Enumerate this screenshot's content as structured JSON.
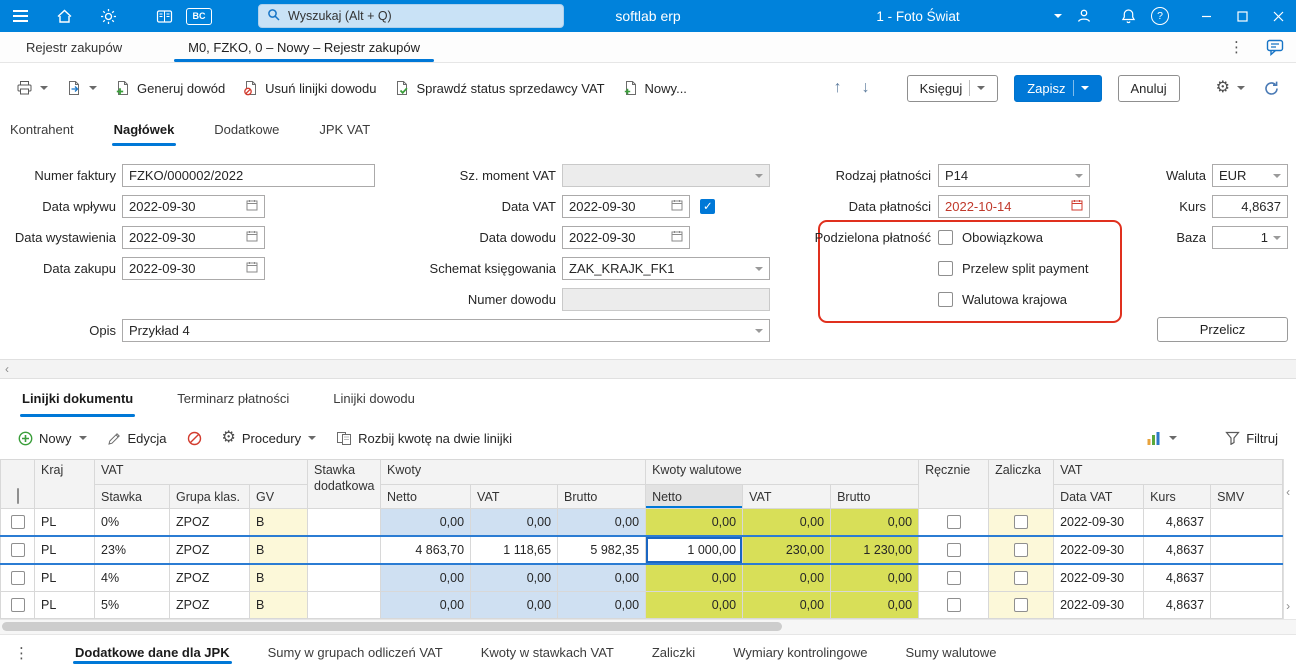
{
  "colors": {
    "titlebar": "#0082db",
    "accent": "#0078d7",
    "attention": "#e0301e",
    "cell_blue": "#cfe0f2",
    "cell_green": "#d8df58",
    "cell_yellow": "#fcf8d9"
  },
  "icons": {
    "dots": "⋮",
    "help": "?",
    "arrow_up": "↑",
    "arrow_down": "↓",
    "gear": "⚙",
    "side_left": "‹",
    "side_right": "›"
  },
  "titlebar": {
    "app_name": "softlab erp",
    "search_placeholder": "Wyszukaj (Alt + Q)",
    "company": "1 - Foto Świat",
    "bc_badge": "BC"
  },
  "doc_tabs": {
    "breadcrumb": "Rejestr zakupów",
    "active": "M0, FZKO, 0 – Nowy – Rejestr zakupów"
  },
  "toolbar": {
    "generate": "Generuj dowód",
    "remove_lines": "Usuń linijki dowodu",
    "check_vat": "Sprawdź status sprzedawcy VAT",
    "new": "Nowy...",
    "post": "Księguj",
    "save": "Zapisz",
    "cancel": "Anuluj"
  },
  "form_tabs": [
    "Kontrahent",
    "Nagłówek",
    "Dodatkowe",
    "JPK VAT"
  ],
  "form": {
    "invoice_number": {
      "label": "Numer faktury",
      "value": "FZKO/000002/2022"
    },
    "receipt_date": {
      "label": "Data wpływu",
      "value": "2022-09-30"
    },
    "issue_date": {
      "label": "Data wystawienia",
      "value": "2022-09-30"
    },
    "purchase_date": {
      "label": "Data zakupu",
      "value": "2022-09-30"
    },
    "description": {
      "label": "Opis",
      "value": "Przykład 4"
    },
    "vat_moment": {
      "label": "Sz. moment VAT",
      "value": ""
    },
    "vat_date": {
      "label": "Data VAT",
      "value": "2022-09-30"
    },
    "document_date": {
      "label": "Data dowodu",
      "value": "2022-09-30"
    },
    "posting_scheme": {
      "label": "Schemat księgowania",
      "value": "ZAK_KRAJK_FK1"
    },
    "document_number": {
      "label": "Numer dowodu",
      "value": ""
    },
    "payment_type": {
      "label": "Rodzaj płatności",
      "value": "P14"
    },
    "payment_date": {
      "label": "Data płatności",
      "value": "2022-10-14"
    },
    "split_payment": {
      "label": "Podzielona płatność",
      "options": [
        "Obowiązkowa",
        "Przelew split payment",
        "Walutowa krajowa"
      ]
    },
    "currency": {
      "label": "Waluta",
      "value": "EUR"
    },
    "rate": {
      "label": "Kurs",
      "value": "4,8637"
    },
    "base": {
      "label": "Baza",
      "value": "1"
    },
    "recalculate": "Przelicz"
  },
  "lower_tabs": [
    "Linijki dokumentu",
    "Terminarz płatności",
    "Linijki dowodu"
  ],
  "grid_toolbar": {
    "new": "Nowy",
    "edit": "Edycja",
    "procedures": "Procedury",
    "split_amount": "Rozbij kwotę na dwie linijki",
    "filter": "Filtruj"
  },
  "grid": {
    "bands": {
      "kraj": "Kraj",
      "vat": "VAT",
      "stawka_dodatkowa": "Stawka dodatkowa",
      "kwoty": "Kwoty",
      "kwoty_walutowe": "Kwoty walutowe",
      "recznie": "Ręcznie",
      "zaliczka": "Zaliczka",
      "vat2": "VAT"
    },
    "cols": {
      "stawka": "Stawka",
      "grupa": "Grupa klas.",
      "gv": "GV",
      "netto": "Netto",
      "vat": "VAT",
      "brutto": "Brutto",
      "wal_netto": "Netto",
      "wal_vat": "VAT",
      "wal_brutto": "Brutto",
      "data_vat": "Data VAT",
      "kurs": "Kurs",
      "smv": "SMV"
    },
    "rows": [
      {
        "kraj": "PL",
        "stawka": "0%",
        "grupa": "ZPOZ",
        "gv": "B",
        "netto": "0,00",
        "vat": "0,00",
        "brutto": "0,00",
        "wal_netto": "0,00",
        "wal_vat": "0,00",
        "wal_brutto": "0,00",
        "data_vat": "2022-09-30",
        "kurs": "4,8637"
      },
      {
        "kraj": "PL",
        "stawka": "23%",
        "grupa": "ZPOZ",
        "gv": "B",
        "netto": "4 863,70",
        "vat": "1 118,65",
        "brutto": "5 982,35",
        "wal_netto": "1 000,00",
        "wal_vat": "230,00",
        "wal_brutto": "1 230,00",
        "data_vat": "2022-09-30",
        "kurs": "4,8637"
      },
      {
        "kraj": "PL",
        "stawka": "4%",
        "grupa": "ZPOZ",
        "gv": "B",
        "netto": "0,00",
        "vat": "0,00",
        "brutto": "0,00",
        "wal_netto": "0,00",
        "wal_vat": "0,00",
        "wal_brutto": "0,00",
        "data_vat": "2022-09-30",
        "kurs": "4,8637"
      },
      {
        "kraj": "PL",
        "stawka": "5%",
        "grupa": "ZPOZ",
        "gv": "B",
        "netto": "0,00",
        "vat": "0,00",
        "brutto": "0,00",
        "wal_netto": "0,00",
        "wal_vat": "0,00",
        "wal_brutto": "0,00",
        "data_vat": "2022-09-30",
        "kurs": "4,8637"
      }
    ]
  },
  "bottom_tabs": [
    "Dodatkowe dane dla JPK",
    "Sumy w grupach odliczeń VAT",
    "Kwoty w stawkach VAT",
    "Zaliczki",
    "Wymiary kontrolingowe",
    "Sumy walutowe"
  ]
}
